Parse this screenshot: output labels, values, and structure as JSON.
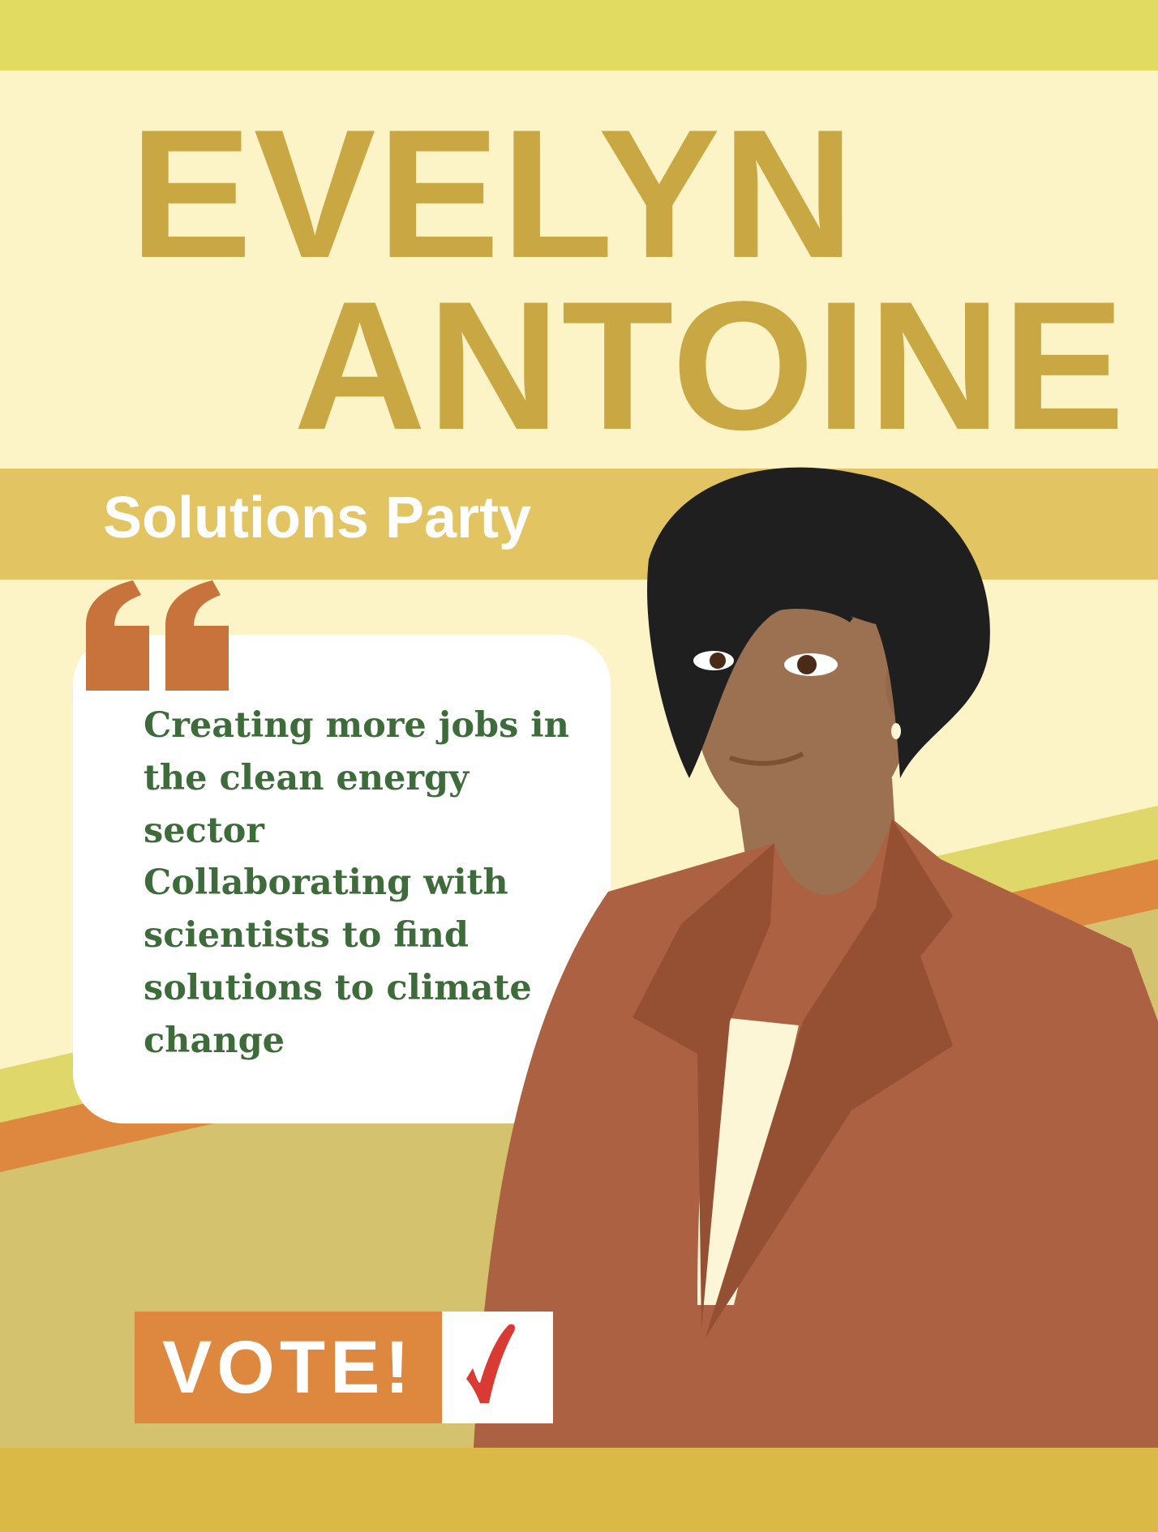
{
  "candidate": {
    "first_name": "EVELYN",
    "last_name": "ANTOINE"
  },
  "party": "Solutions Party",
  "quote": {
    "icon": "quote-mark-icon",
    "points": [
      "Creating more jobs in the clean energy sector",
      "Collaborating with scientists to find solutions to climate change"
    ]
  },
  "call_to_action": {
    "label": "VOTE!",
    "icon": "checkmark-icon"
  },
  "colors": {
    "background": "#fcf4c6",
    "top_band": "#e2db62",
    "name": "#c9a843",
    "party_band": "#e2c462",
    "quote_mark": "#c8733b",
    "quote_text": "#3d6b3a",
    "stripe_yellow": "#e0d76a",
    "stripe_orange": "#de873e",
    "ground": "#d4c26e",
    "bottom_band": "#dbb947",
    "check": "#d93a33"
  }
}
